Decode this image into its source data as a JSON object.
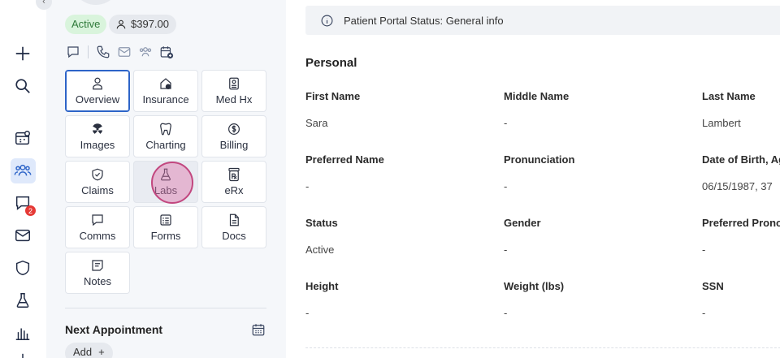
{
  "rail": {
    "items": [
      {
        "name": "add-icon"
      },
      {
        "name": "search-icon"
      },
      {
        "name": "dashboard-icon"
      },
      {
        "name": "patients-icon",
        "active": true
      },
      {
        "name": "messages-icon",
        "badge": "2"
      },
      {
        "name": "mail-icon"
      },
      {
        "name": "shield-icon"
      },
      {
        "name": "lab-flask-icon"
      },
      {
        "name": "reports-icon"
      }
    ]
  },
  "patient": {
    "status": "Active",
    "balance": "$397.00",
    "contacts": [
      "chat-icon",
      "phone-icon",
      "email-icon",
      "family-icon",
      "calendar-add-icon"
    ]
  },
  "tiles": [
    {
      "label": "Overview",
      "icon": "person-icon",
      "selected": true
    },
    {
      "label": "Insurance",
      "icon": "insurance-icon"
    },
    {
      "label": "Med Hx",
      "icon": "medical-history-icon"
    },
    {
      "label": "Images",
      "icon": "radiation-icon"
    },
    {
      "label": "Charting",
      "icon": "tooth-icon"
    },
    {
      "label": "Billing",
      "icon": "billing-icon"
    },
    {
      "label": "Claims",
      "icon": "claims-shield-icon"
    },
    {
      "label": "Labs",
      "icon": "flask-icon",
      "hovered": true
    },
    {
      "label": "eRx",
      "icon": "prescription-icon"
    },
    {
      "label": "Comms",
      "icon": "comment-icon"
    },
    {
      "label": "Forms",
      "icon": "forms-icon"
    },
    {
      "label": "Docs",
      "icon": "document-icon"
    },
    {
      "label": "Notes",
      "icon": "notes-icon"
    }
  ],
  "appointment": {
    "title": "Next Appointment",
    "add_label": "Add",
    "add_symbol": "+"
  },
  "portal": {
    "status_text": "Patient Portal Status: General info"
  },
  "personal": {
    "title": "Personal",
    "fields": [
      {
        "label": "First Name",
        "value": "Sara"
      },
      {
        "label": "Middle Name",
        "value": "-"
      },
      {
        "label": "Last Name",
        "value": "Lambert"
      },
      {
        "label": "Preferred Name",
        "value": "-"
      },
      {
        "label": "Pronunciation",
        "value": "-"
      },
      {
        "label": "Date of Birth, Ag",
        "value": "06/15/1987, 37"
      },
      {
        "label": "Status",
        "value": "Active"
      },
      {
        "label": "Gender",
        "value": "-"
      },
      {
        "label": "Preferred Pronou",
        "value": "-"
      },
      {
        "label": "Height",
        "value": "-"
      },
      {
        "label": "Weight (lbs)",
        "value": "-"
      },
      {
        "label": "SSN",
        "value": "-"
      }
    ]
  },
  "colors": {
    "accent": "#2d64c8",
    "active_pill_bg": "#d9f4dc",
    "active_pill_text": "#2f7a3a",
    "badge": "#e53935",
    "panel_bg": "#f5f7fa"
  }
}
